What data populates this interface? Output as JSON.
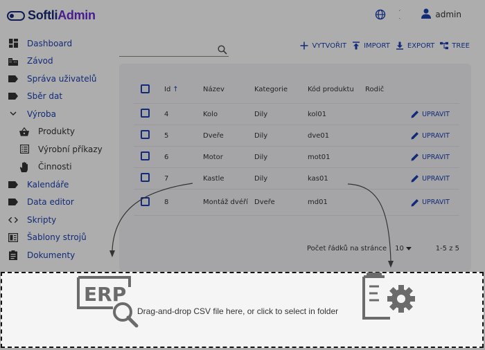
{
  "header": {
    "logo_part1": "Softli",
    "logo_part2": "Admin",
    "user_name": "admin"
  },
  "sidebar": {
    "items": [
      {
        "label": "Dashboard",
        "icon": "dashboard-icon"
      },
      {
        "label": "Závod",
        "icon": "factory-icon"
      },
      {
        "label": "Správa uživatelů",
        "icon": "label-icon"
      },
      {
        "label": "Sběr dat",
        "icon": "label-icon"
      },
      {
        "label": "Výroba",
        "icon": "chevron-down-icon"
      },
      {
        "label": "Produkty",
        "icon": "basket-icon"
      },
      {
        "label": "Výrobní příkazy",
        "icon": "list-icon"
      },
      {
        "label": "Činnosti",
        "icon": "hand-icon"
      },
      {
        "label": "Kalendáře",
        "icon": "label-icon"
      },
      {
        "label": "Data editor",
        "icon": "label-icon"
      },
      {
        "label": "Skripty",
        "icon": "code-icon"
      },
      {
        "label": "Šablony strojů",
        "icon": "template-icon"
      },
      {
        "label": "Dokumenty",
        "icon": "clipboard-icon"
      }
    ]
  },
  "toolbar": {
    "create": "VYTVOŘIT",
    "import": "IMPORT",
    "export": "EXPORT",
    "tree": "TREE"
  },
  "table": {
    "headers": {
      "id": "Id",
      "name": "Název",
      "category": "Kategorie",
      "code": "Kód produktu",
      "parent": "Rodič"
    },
    "edit_label": "UPRAVIT",
    "rows": [
      {
        "id": "4",
        "name": "Kolo",
        "category": "Dily",
        "code": "kol01"
      },
      {
        "id": "5",
        "name": "Dveře",
        "category": "Dily",
        "code": "dve01"
      },
      {
        "id": "6",
        "name": "Motor",
        "category": "Dily",
        "code": "mot01"
      },
      {
        "id": "7",
        "name": "Kastle",
        "category": "Dily",
        "code": "kas01"
      },
      {
        "id": "8",
        "name": "Montáž dvéří",
        "category": "Dveře",
        "code": "md01"
      }
    ]
  },
  "pager": {
    "rows_per_page_label": "Počet řádků na stránce",
    "rows_per_page_value": "10",
    "range": "1-5 z 5"
  },
  "dropzone": {
    "text": "Drag-and-drop CSV file here, or click to select in folder",
    "erp_logo": "ERP"
  },
  "colors": {
    "primary": "#1b3fb0",
    "brand": "#1b2a7a",
    "brand_accent": "#6a2bd1"
  }
}
